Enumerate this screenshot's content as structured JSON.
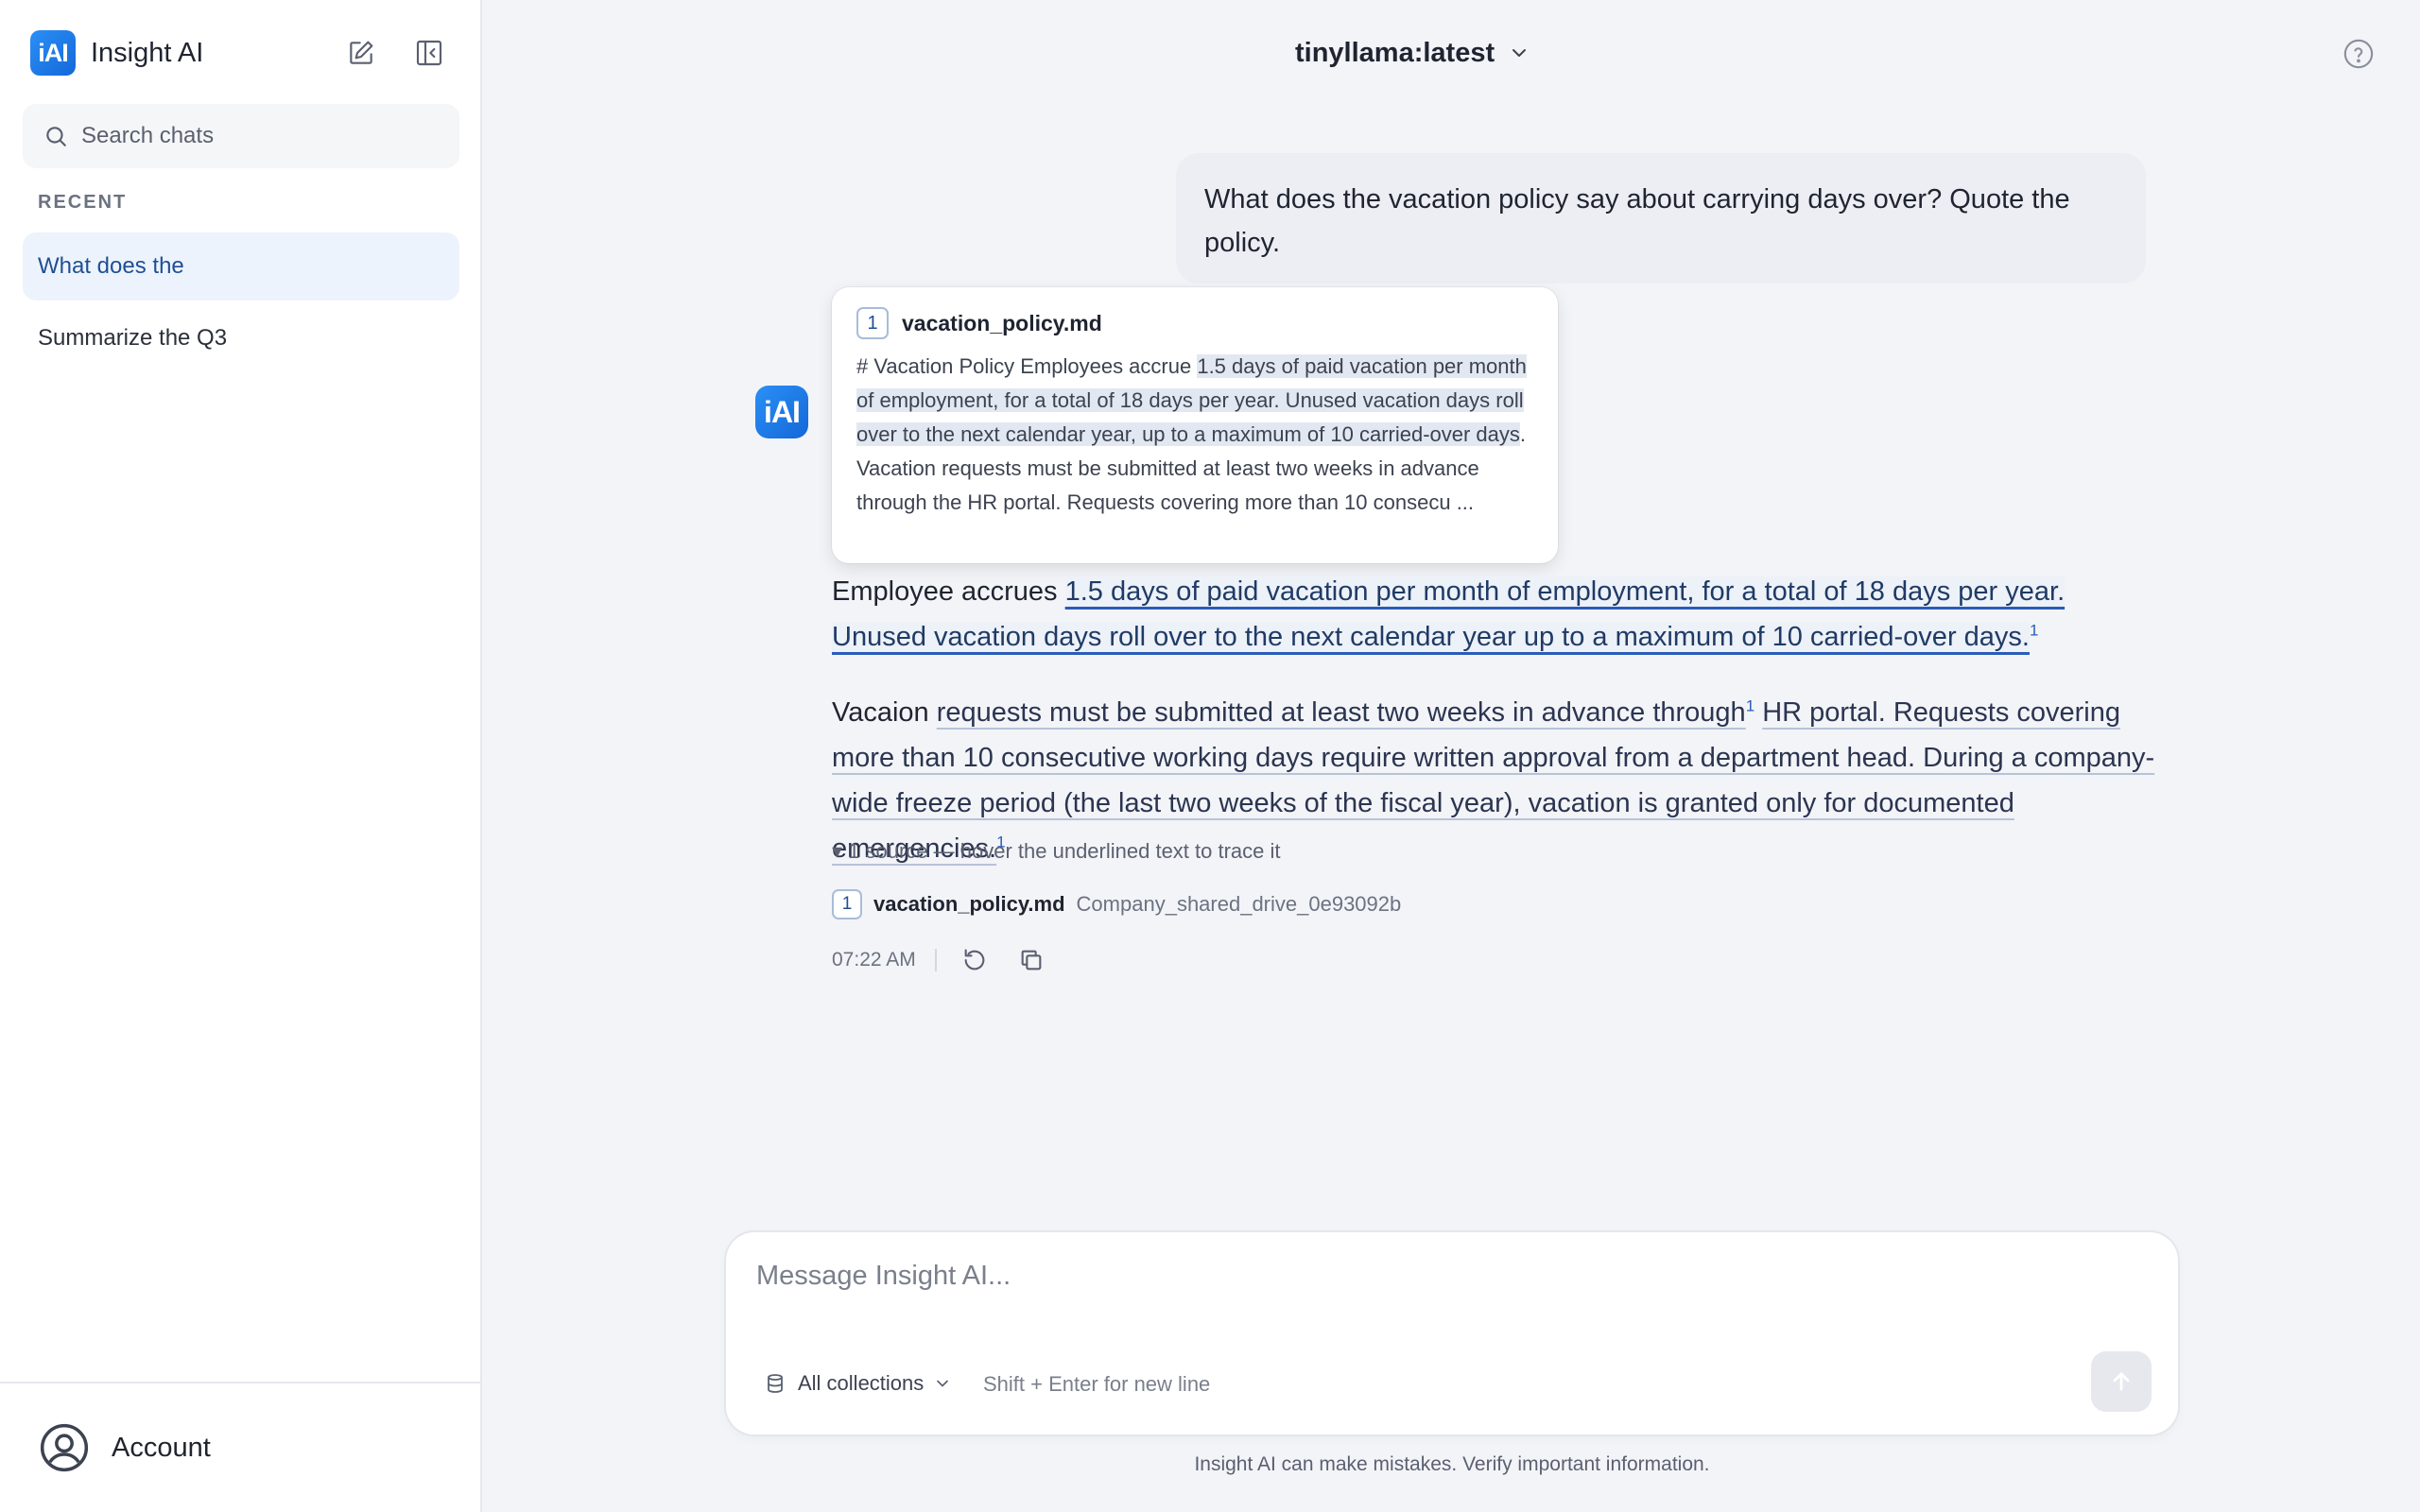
{
  "app": {
    "name": "Insight AI",
    "logo_text": "iAI"
  },
  "sidebar": {
    "search_placeholder": "Search chats",
    "section_label": "RECENT",
    "chats": [
      {
        "label": "What does the"
      },
      {
        "label": "Summarize the Q3"
      }
    ],
    "account_label": "Account"
  },
  "header": {
    "model": "tinyllama:latest"
  },
  "conversation": {
    "user_message": "What does the vacation policy say about carrying days over? Quote the policy.",
    "assistant": {
      "avatar_text": "iAI",
      "popover": {
        "num": "1",
        "title": "vacation_policy.md",
        "pre": "# Vacation Policy Employees accrue ",
        "highlight": "1.5 days of paid vacation per month of employment, for a total of 18 days per year. Unused vacation days roll over to the next calendar year, up to a maximum of 10 carried-over days",
        "post": ". Vacation requests must be submitted at least two weeks in advance through the HR portal. Requests covering more than 10 consecu ..."
      },
      "para1": {
        "pre": "Employee accrues ",
        "cited": "1.5 days of paid vacation per month of employment, for a total of 18 days per year. Unused vacation days roll over to the next calendar year up to a maximum of 10 carried-over days.",
        "cite": "1"
      },
      "para2": {
        "pre": "Vacaion ",
        "cited_a": "requests must be submitted at least two weeks in advance through",
        "cite_a": "1",
        "mid": " ",
        "cited_b": "HR portal. Requests covering more than 10 consecutive working days require written approval from a department head. During a company-wide freeze period (the last two weeks of the fiscal year), vacation is granted only for documented emergencies.",
        "cite_b": "1"
      },
      "sources_toggle": "▾ 1 source — hover the underlined text to trace it",
      "source": {
        "num": "1",
        "name": "vacation_policy.md",
        "location": "Company_shared_drive_0e93092b"
      },
      "time": "07:22 AM"
    }
  },
  "composer": {
    "placeholder": "Message Insight AI...",
    "collections": "All collections",
    "hint": "Shift + Enter for new line"
  },
  "disclaimer": "Insight AI can make mistakes. Verify important information.",
  "colors": {
    "accent": "#1468d8",
    "active_chat_bg": "#edf3fc",
    "citation": "#2a5cb8"
  },
  "icons": [
    "new-chat-icon",
    "collapse-sidebar-icon",
    "search-icon",
    "account-icon",
    "chevron-down-icon",
    "help-icon",
    "regenerate-icon",
    "copy-icon",
    "database-icon",
    "send-arrow-icon"
  ]
}
